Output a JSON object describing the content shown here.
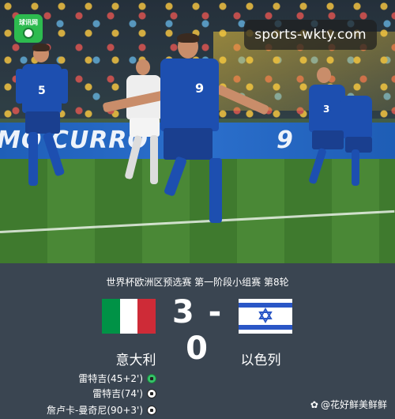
{
  "photo": {
    "logo": {
      "text": "球讯网",
      "icon": "soccer-ball-icon"
    },
    "watermark": "sports-wkty.com",
    "ad_board_left": "MO CURRO",
    "ad_board_right": "9",
    "player_numbers": [
      "5",
      "9",
      "3"
    ]
  },
  "match": {
    "competition": "世界杯欧洲区预选赛 第一阶段小组赛 第8轮",
    "score": "3 - 0",
    "home": {
      "name": "意大利",
      "flag": "italy-flag-icon"
    },
    "away": {
      "name": "以色列",
      "flag": "israel-flag-icon"
    },
    "scorers": [
      {
        "text": "雷特吉(45+2')",
        "icon": "penalty-ball-icon"
      },
      {
        "text": "雷特吉(74')",
        "icon": "soccer-ball-icon"
      },
      {
        "text": "詹卢卡-曼奇尼(90+3')",
        "icon": "soccer-ball-icon"
      }
    ]
  },
  "credit": {
    "icon": "paw-icon",
    "text": "@花好鲜美鲜鲜"
  },
  "colors": {
    "italy_green": "#009246",
    "italy_white": "#ffffff",
    "italy_red": "#ce2b37",
    "israel_blue": "#2a56c6",
    "panel_bg": "#3a4551",
    "azzurri_blue": "#1d4fb0"
  }
}
